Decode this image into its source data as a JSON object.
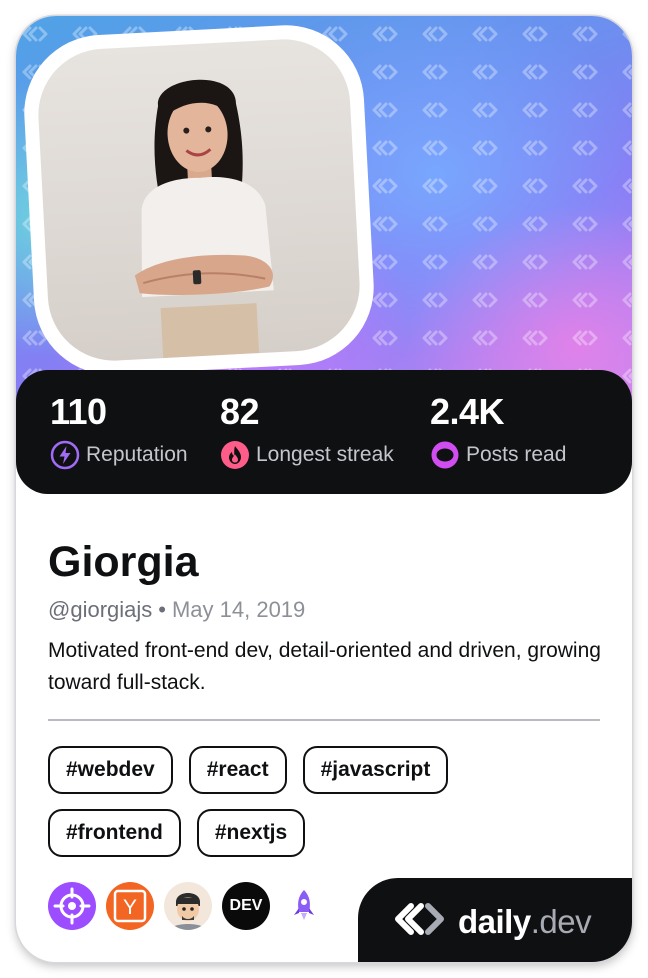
{
  "profile": {
    "name": "Giorgia",
    "handle": "@giorgiajs",
    "separator": "•",
    "joined": "May 14, 2019",
    "bio": "Motivated front-end dev, detail-oriented and driven, growing toward full-stack."
  },
  "stats": [
    {
      "value": "110",
      "label": "Reputation",
      "icon": "reputation-bolt-icon",
      "color": "#a06bf5"
    },
    {
      "value": "82",
      "label": "Longest streak",
      "icon": "streak-flame-icon",
      "color": "#ff5c8a"
    },
    {
      "value": "2.4K",
      "label": "Posts read",
      "icon": "posts-read-eye-icon",
      "color": "#d04ef0"
    }
  ],
  "tags": {
    "row1": [
      "#webdev",
      "#react",
      "#javascript"
    ],
    "row2": [
      "#frontend",
      "#nextjs"
    ]
  },
  "squads": [
    {
      "icon": "crosshair-squad-icon",
      "color": "#9b4dff"
    },
    {
      "icon": "y-combinator-squad-icon",
      "color": "#f26522",
      "text": "Y"
    },
    {
      "icon": "memoji-squad-icon",
      "color": "#f3e6da"
    },
    {
      "icon": "dev-squad-icon",
      "color": "#0a0a0a",
      "text": "DEV"
    },
    {
      "icon": "rocket-squad-icon",
      "color": "#8b5cf6"
    }
  ],
  "brand": {
    "word_main": "daily",
    "word_suffix": ".dev",
    "icon": "daily-dev-logo-icon"
  },
  "colors": {
    "card_dark": "#0f1012",
    "muted_text": "#6c6f78"
  }
}
